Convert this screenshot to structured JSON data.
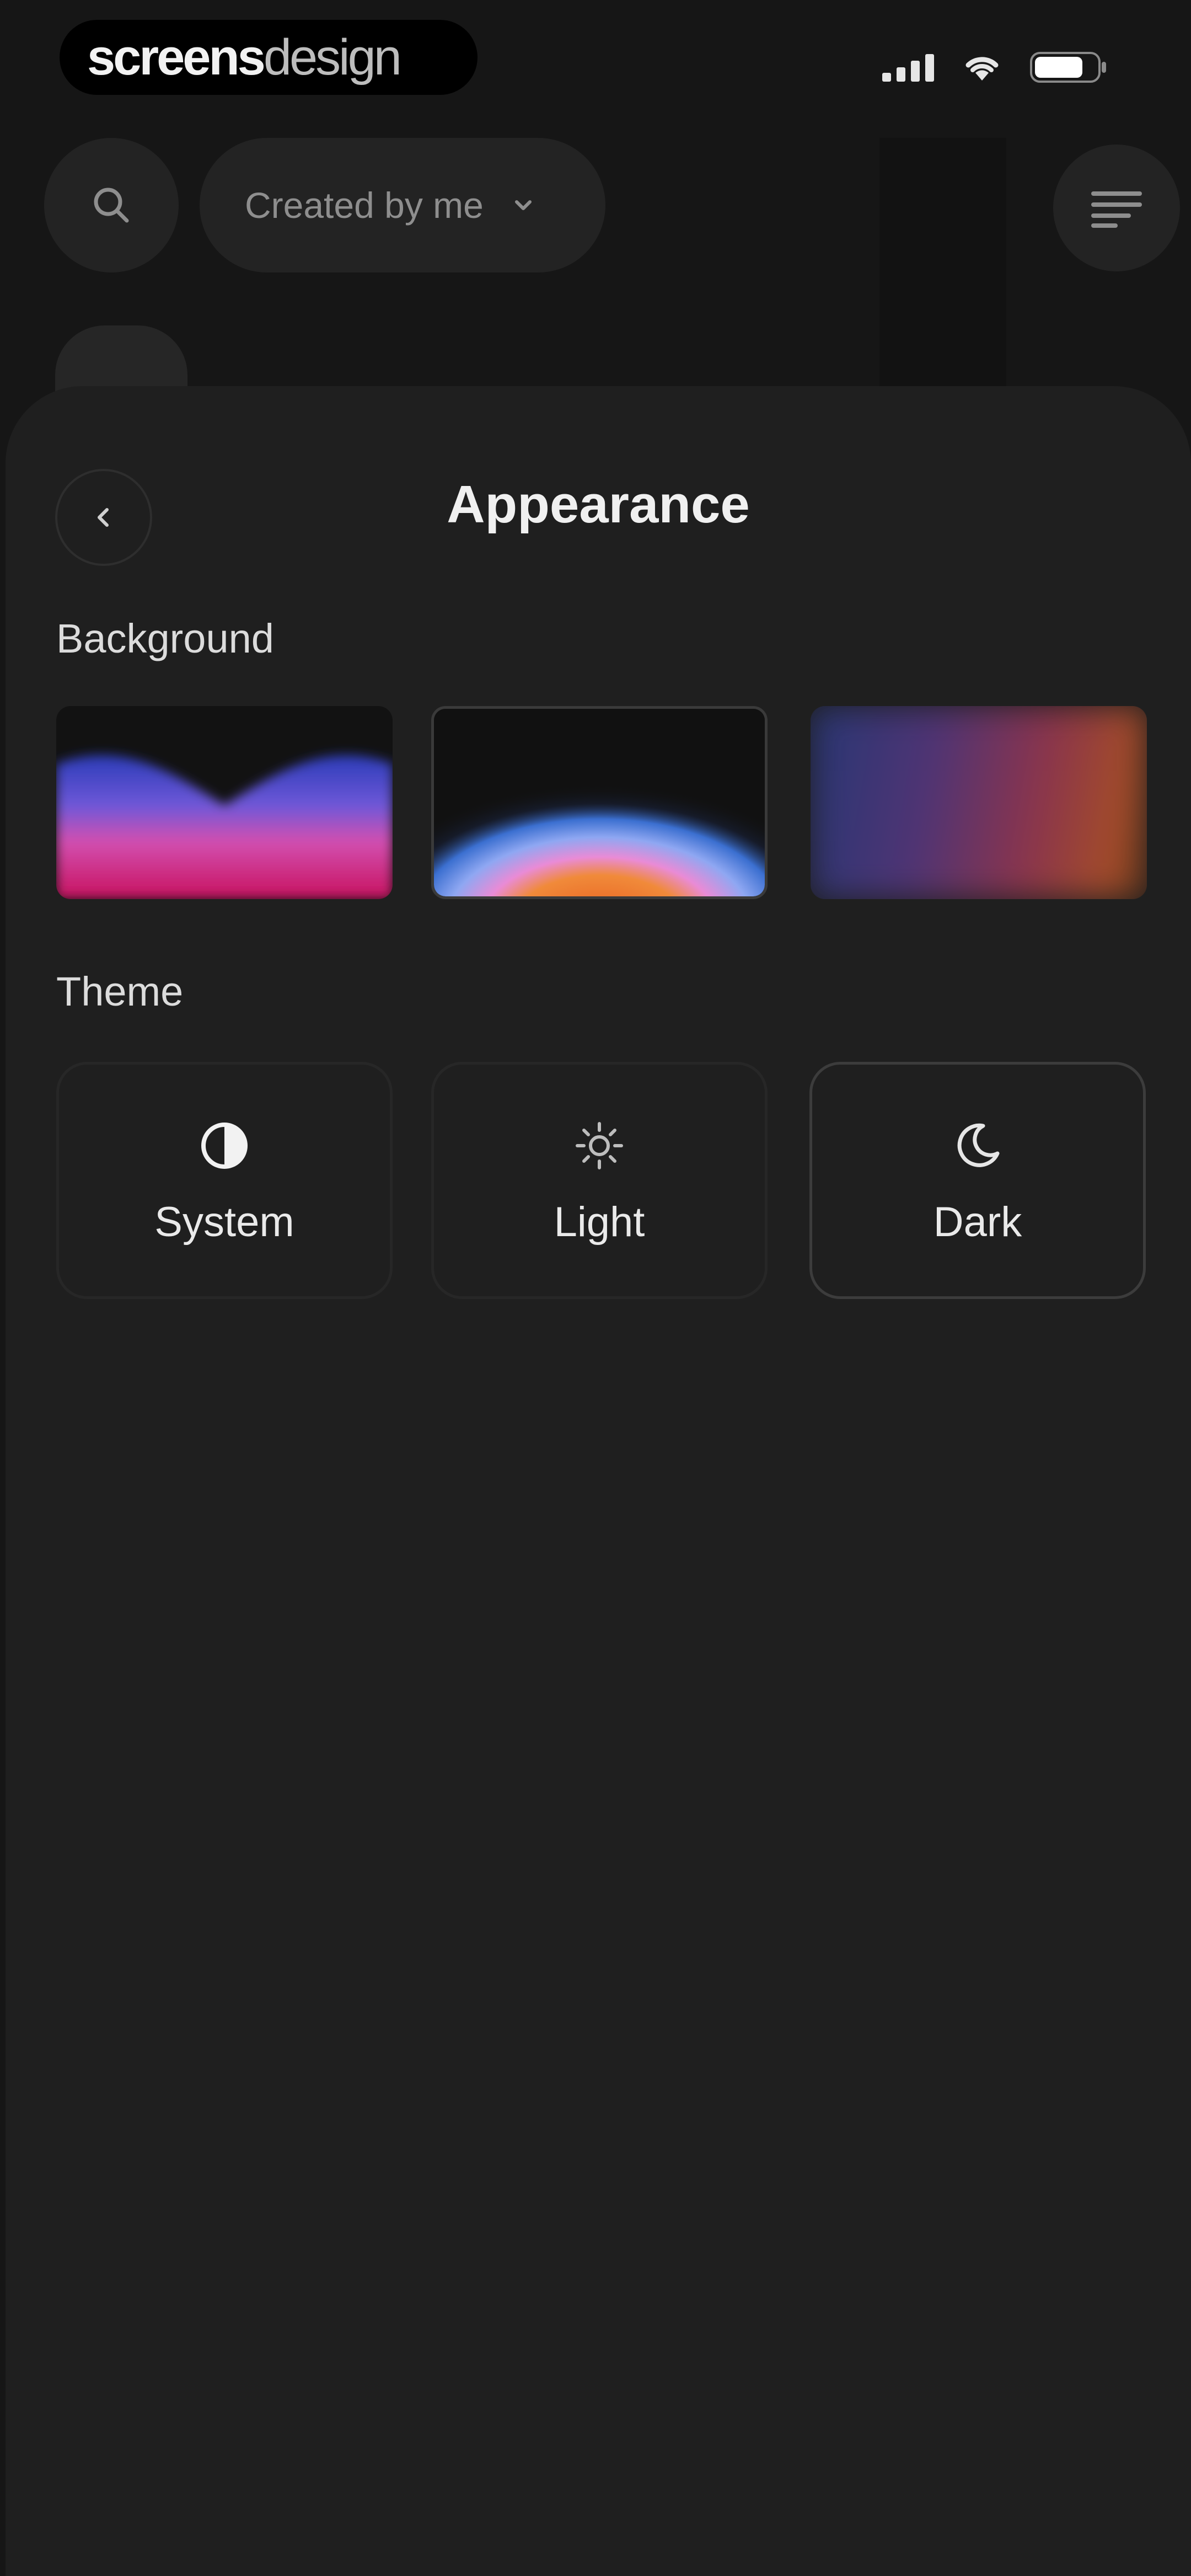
{
  "status_bar": {
    "brand_word1": "screens",
    "brand_word2": "design",
    "icons": [
      "cellular-signal-icon",
      "wifi-icon",
      "battery-icon"
    ]
  },
  "toolbar": {
    "filter_label": "Created by me",
    "icons": [
      "search-icon",
      "chevron-down-icon",
      "sort-menu-icon"
    ]
  },
  "sheet": {
    "title": "Appearance",
    "back_icon": "chevron-left-icon",
    "background_section": {
      "label": "Background",
      "selected_index": 1
    },
    "theme_section": {
      "label": "Theme",
      "options": [
        {
          "label": "System",
          "icon": "half-circle-contrast-icon"
        },
        {
          "label": "Light",
          "icon": "sun-icon"
        },
        {
          "label": "Dark",
          "icon": "moon-icon"
        }
      ],
      "selected": "Dark"
    }
  },
  "colors": {
    "background": "#161616",
    "sheet": "#1f1f1f",
    "text_primary": "#f0f0f0",
    "text_muted": "#8e8e8e"
  }
}
